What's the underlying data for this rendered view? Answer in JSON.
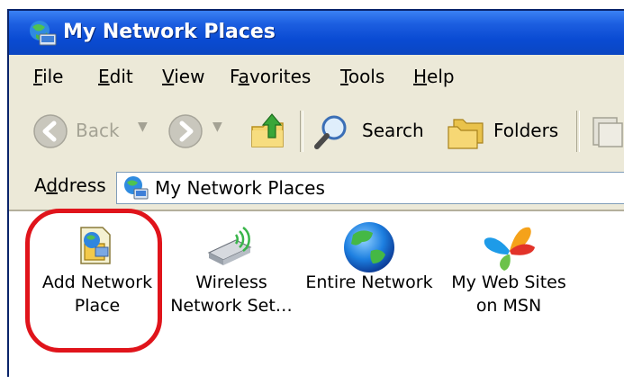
{
  "window": {
    "title": "My Network Places"
  },
  "menu": [
    {
      "pre": "",
      "u": "F",
      "post": "ile"
    },
    {
      "pre": "",
      "u": "E",
      "post": "dit"
    },
    {
      "pre": "",
      "u": "V",
      "post": "iew"
    },
    {
      "pre": "F",
      "u": "a",
      "post": "vorites"
    },
    {
      "pre": "",
      "u": "T",
      "post": "ools"
    },
    {
      "pre": "",
      "u": "H",
      "post": "elp"
    }
  ],
  "toolbar": {
    "back_label": "Back",
    "search_label": "Search",
    "folders_label": "Folders"
  },
  "address": {
    "label_pre": "A",
    "label_u": "d",
    "label_post": "dress",
    "value": "My Network Places"
  },
  "items": [
    {
      "label": "Add Network\nPlace",
      "icon": "add-network-place-icon"
    },
    {
      "label": "Wireless\nNetwork Set…",
      "icon": "wireless-adapter-icon"
    },
    {
      "label": "Entire Network",
      "icon": "globe-icon"
    },
    {
      "label": "My Web Sites\non MSN",
      "icon": "msn-butterfly-icon"
    }
  ],
  "colors": {
    "titlebar": "#0a4bd3",
    "highlight": "#e0141b",
    "chrome": "#ece9d8"
  }
}
